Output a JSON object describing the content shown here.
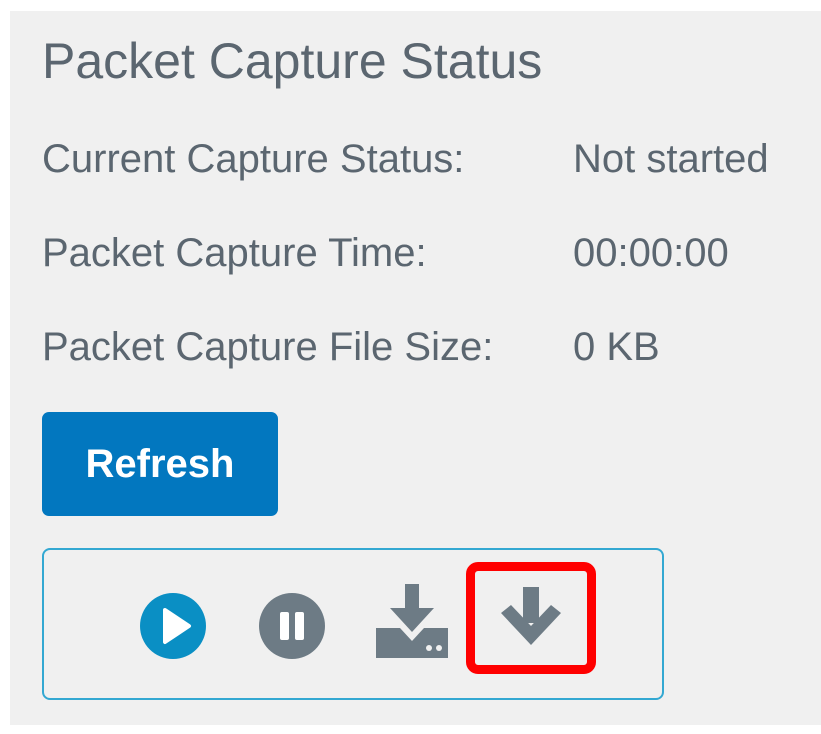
{
  "panel": {
    "title": "Packet Capture Status"
  },
  "status": {
    "current_capture_status_label": "Current Capture Status:",
    "current_capture_status_value": "Not started",
    "packet_capture_time_label": "Packet Capture Time:",
    "packet_capture_time_value": "00:00:00",
    "packet_capture_file_size_label": "Packet Capture File Size:",
    "packet_capture_file_size_value": "0 KB"
  },
  "buttons": {
    "refresh_label": "Refresh"
  },
  "toolbar": {
    "icons": [
      "play-icon",
      "pause-icon",
      "download-file-icon",
      "download-icon"
    ],
    "highlighted": "download-icon"
  },
  "colors": {
    "text": "#5b6670",
    "primary": "#0277bf",
    "play_icon": "#0a8fc4",
    "pause_icon": "#6d7b85",
    "toolbar_border": "#33a8d2",
    "highlight": "#ff0000",
    "panel_background": "#f0f0f0"
  }
}
